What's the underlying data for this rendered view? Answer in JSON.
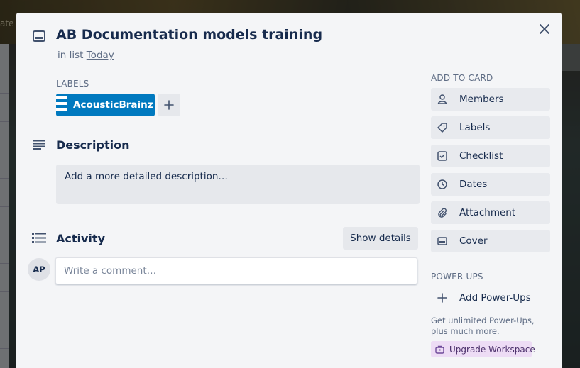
{
  "card": {
    "title": "AB Documentation models training",
    "in_list_prefix": "in list",
    "list_name": "Today"
  },
  "labels": {
    "heading": "LABELS",
    "items": [
      {
        "name": "AcousticBrainz",
        "color": "#0079bf"
      }
    ]
  },
  "description": {
    "heading": "Description",
    "placeholder": "Add a more detailed description…"
  },
  "activity": {
    "heading": "Activity",
    "show_details": "Show details",
    "avatar_initials": "AP",
    "comment_placeholder": "Write a comment…"
  },
  "sidebar": {
    "add_to_card_heading": "ADD TO CARD",
    "buttons": [
      {
        "label": "Members",
        "icon": "person-icon"
      },
      {
        "label": "Labels",
        "icon": "tag-icon"
      },
      {
        "label": "Checklist",
        "icon": "checklist-icon"
      },
      {
        "label": "Dates",
        "icon": "clock-icon"
      },
      {
        "label": "Attachment",
        "icon": "paperclip-icon"
      },
      {
        "label": "Cover",
        "icon": "cover-icon"
      }
    ],
    "powerups_heading": "POWER-UPS",
    "add_powerups": "Add Power-Ups",
    "upsell_line1": "Get unlimited Power-Ups,",
    "upsell_line2": "plus much more.",
    "upgrade_label": "Upgrade Workspace",
    "upgrade_color": "#eddcf5"
  },
  "background_peek_text": "ate"
}
